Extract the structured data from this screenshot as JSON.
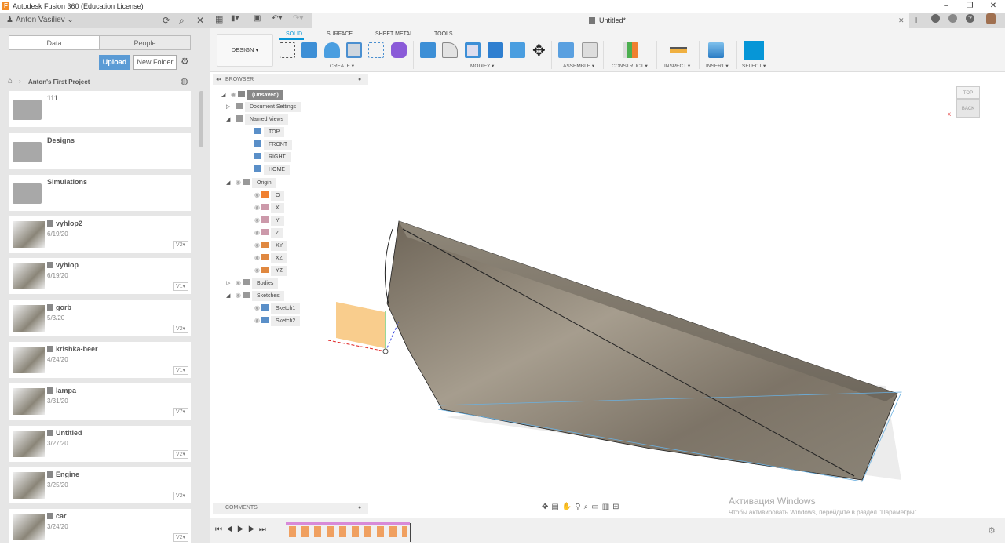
{
  "window": {
    "title": "Autodesk Fusion 360 (Education License)",
    "minimize": "–",
    "restore": "❐",
    "close": "✕"
  },
  "data_panel": {
    "user": "Anton Vasiliev",
    "tabs": [
      "Data",
      "People"
    ],
    "upload": "Upload",
    "new_folder": "New Folder",
    "project": "Anton's First Project",
    "folders": [
      "111",
      "Designs",
      "Simulations"
    ],
    "files": [
      {
        "name": "vyhlop2",
        "date": "6/19/20",
        "version": "V2"
      },
      {
        "name": "vyhlop",
        "date": "6/19/20",
        "version": "V1"
      },
      {
        "name": "gorb",
        "date": "5/3/20",
        "version": "V2"
      },
      {
        "name": "krishka-beer",
        "date": "4/24/20",
        "version": "V1"
      },
      {
        "name": "lampa",
        "date": "3/31/20",
        "version": "V7"
      },
      {
        "name": "Untitled",
        "date": "3/27/20",
        "version": "V2"
      },
      {
        "name": "Engine",
        "date": "3/25/20",
        "version": "V2"
      },
      {
        "name": "car",
        "date": "3/24/20",
        "version": "V2"
      }
    ]
  },
  "document": {
    "tab": "Untitled*"
  },
  "ribbon": {
    "workspace": "DESIGN ▾",
    "tabs": [
      "SOLID",
      "SURFACE",
      "SHEET METAL",
      "TOOLS"
    ],
    "groups": [
      "CREATE ▾",
      "MODIFY ▾",
      "ASSEMBLE ▾",
      "CONSTRUCT ▾",
      "INSPECT ▾",
      "INSERT ▾",
      "SELECT ▾"
    ]
  },
  "browser": {
    "title": "BROWSER",
    "root": "(Unsaved)",
    "items": [
      "Document Settings",
      "Named Views",
      "TOP",
      "FRONT",
      "RIGHT",
      "HOME",
      "Origin",
      "O",
      "X",
      "Y",
      "Z",
      "XY",
      "XZ",
      "YZ",
      "Bodies",
      "Sketches",
      "Sketch1",
      "Sketch2"
    ]
  },
  "comments": "COMMENTS",
  "viewcube": {
    "top": "TOP",
    "back": "BACK",
    "x": "X"
  },
  "activation": {
    "title": "Активация Windows",
    "text": "Чтобы активировать Windows, перейдите в раздел \"Параметры\"."
  },
  "accent": "#0696d7"
}
